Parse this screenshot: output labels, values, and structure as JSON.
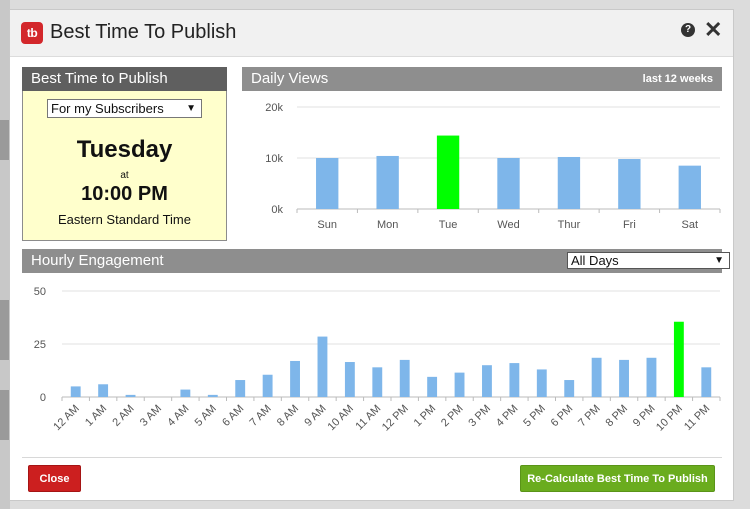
{
  "dialog": {
    "logo_text": "tb",
    "title": "Best Time To Publish",
    "help_glyph": "?",
    "close_glyph": "✕"
  },
  "best_time": {
    "header": "Best Time to Publish",
    "audience_select": "For my Subscribers",
    "day": "Tuesday",
    "at_label": "at",
    "time": "10:00 PM",
    "timezone": "Eastern Standard Time"
  },
  "daily_views": {
    "header": "Daily Views",
    "period": "last 12 weeks"
  },
  "hourly_engagement": {
    "header": "Hourly Engagement",
    "day_select": "All Days"
  },
  "footer": {
    "close_label": "Close",
    "recalc_label": "Re-Calculate Best Time To Publish"
  },
  "colors": {
    "bar": "#7eb6ea",
    "highlight": "#00ff00",
    "grid": "#e0e0e0",
    "axis_text": "#555555"
  },
  "chart_data": [
    {
      "type": "bar",
      "categories": [
        "Sun",
        "Mon",
        "Tue",
        "Wed",
        "Thur",
        "Fri",
        "Sat"
      ],
      "values": [
        10000,
        10400,
        14400,
        10000,
        10200,
        9800,
        8500
      ],
      "highlight_index": 2,
      "yticks": [
        "0k",
        "10k",
        "20k"
      ],
      "ylim": [
        0,
        20000
      ],
      "grid": true
    },
    {
      "type": "bar",
      "categories": [
        "12 AM",
        "1 AM",
        "2 AM",
        "3 AM",
        "4 AM",
        "5 AM",
        "6 AM",
        "7 AM",
        "8 AM",
        "9 AM",
        "10 AM",
        "11 AM",
        "12 PM",
        "1 PM",
        "2 PM",
        "3 PM",
        "4 PM",
        "5 PM",
        "6 PM",
        "7 PM",
        "8 PM",
        "9 PM",
        "10 PM",
        "11 PM"
      ],
      "values": [
        5,
        6,
        1,
        0,
        3.5,
        1,
        8,
        10.5,
        17,
        28.5,
        16.5,
        14,
        17.5,
        9.5,
        11.5,
        15,
        16,
        13,
        8,
        18.5,
        17.5,
        18.5,
        35.5,
        14
      ],
      "highlight_index": 22,
      "yticks": [
        "0",
        "25",
        "50"
      ],
      "ylim": [
        0,
        50
      ],
      "grid": true
    }
  ]
}
